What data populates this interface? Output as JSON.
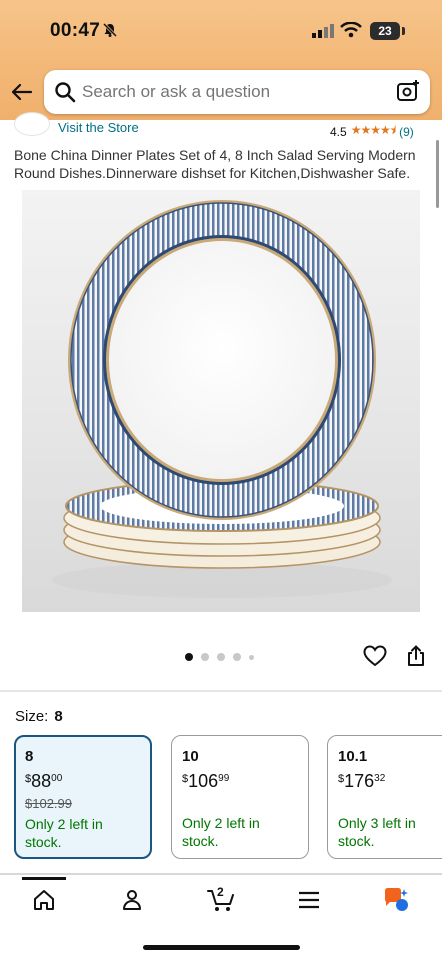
{
  "status_bar": {
    "time": "00:47",
    "battery": "23"
  },
  "search": {
    "placeholder": "Search or ask a question"
  },
  "store": {
    "link_label": "Visit the Store",
    "rating_value": "4.5",
    "rating_count": "(9)",
    "stars": "★★★★⯨"
  },
  "product": {
    "title": "Bone China Dinner Plates Set of 4, 8 Inch Salad Serving Modern Round Dishes.Dinnerware dishset for Kitchen,Dishwasher Safe.",
    "image_count": 5,
    "active_image": 1
  },
  "size": {
    "label": "Size:",
    "selected": "8",
    "options": [
      {
        "name": "8",
        "currency": "$",
        "whole": "88",
        "fraction": "00",
        "list_price": "$102.99",
        "stock": "Only 2 left in stock."
      },
      {
        "name": "10",
        "currency": "$",
        "whole": "106",
        "fraction": "99",
        "list_price": "",
        "stock": "Only 2 left in stock."
      },
      {
        "name": "10.1",
        "currency": "$",
        "whole": "176",
        "fraction": "32",
        "list_price": "",
        "stock": "Only 3 left in stock."
      }
    ]
  },
  "nav": {
    "cart_count": "2",
    "items": [
      "home-icon",
      "account-icon",
      "cart-icon",
      "menu-icon",
      "ai-assistant-icon"
    ]
  },
  "colors": {
    "header": "#f3b877",
    "link": "#007185",
    "stock": "#007600",
    "selected_border": "#1b5680",
    "selected_bg": "#eaf5fb",
    "star": "#de7921"
  }
}
